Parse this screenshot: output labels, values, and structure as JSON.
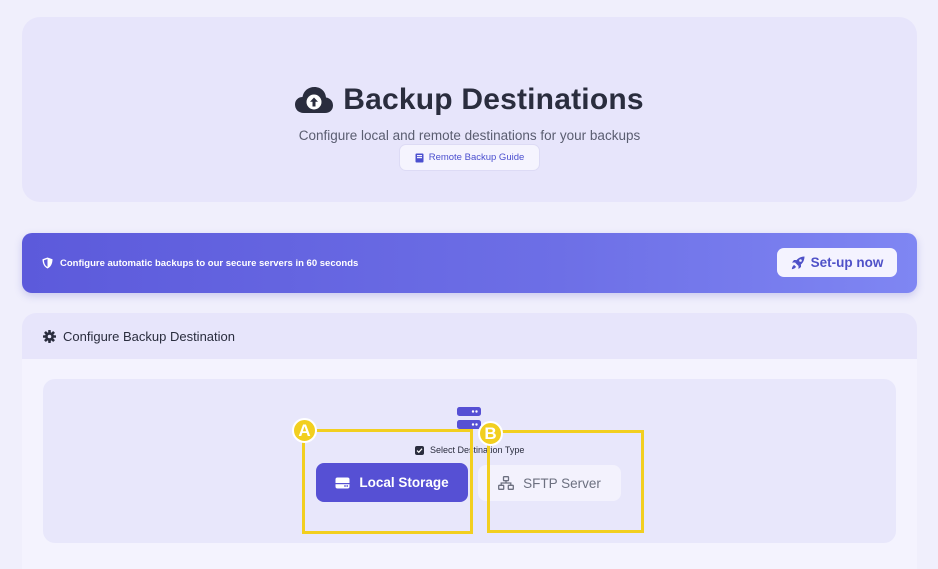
{
  "header": {
    "title": "Backup Destinations",
    "subtitle": "Configure local and remote destinations for your backups",
    "guide_button": "Remote Backup Guide",
    "icons": {
      "title": "cloud-upload-icon",
      "guide": "book-icon"
    }
  },
  "banner": {
    "message": "Configure automatic backups to our secure servers in 60 seconds",
    "button": "Set-up now",
    "icons": {
      "message": "shield-icon",
      "button": "rocket-icon"
    }
  },
  "config": {
    "heading": "Configure Backup Destination",
    "select_label": "Select Destination Type",
    "options": [
      {
        "label": "Local Storage",
        "icon": "hard-drive-icon",
        "selected": true
      },
      {
        "label": "SFTP Server",
        "icon": "network-icon",
        "selected": false
      }
    ],
    "icons": {
      "heading": "gear-icon",
      "illustration": "server-icon",
      "checkbox": "checkbox-icon"
    }
  },
  "annotations": [
    {
      "label": "A"
    },
    {
      "label": "B"
    }
  ],
  "colors": {
    "accent": "#5650d4",
    "banner_start": "#5c5adb",
    "banner_end": "#7f86f3",
    "annotation": "#f2cf1f"
  }
}
